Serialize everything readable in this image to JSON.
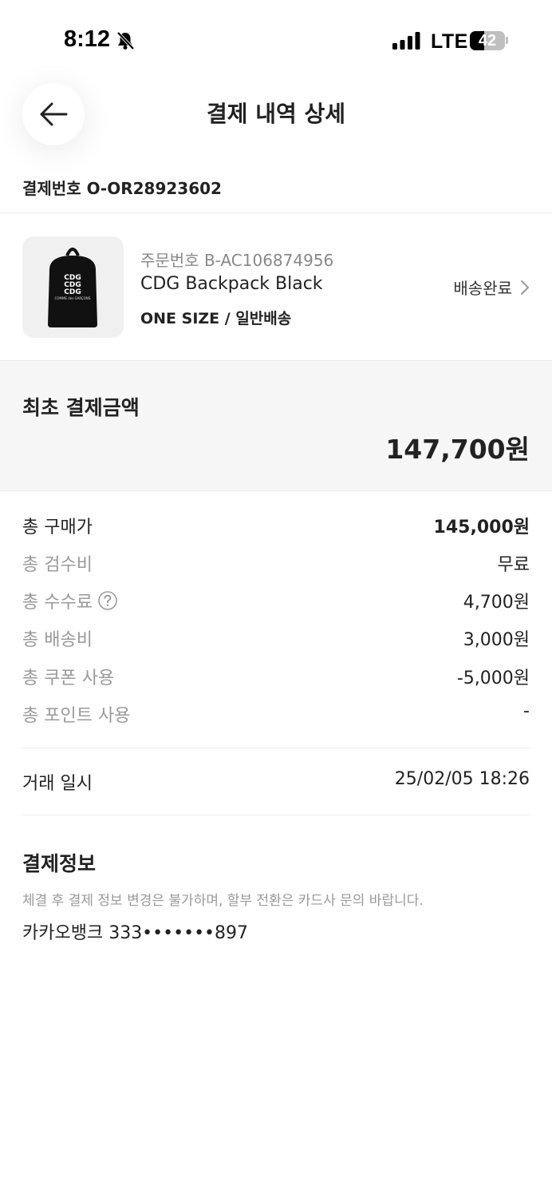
{
  "status_bar": {
    "time": "8:12",
    "network": "LTE",
    "battery": "42",
    "battery_level": 0.42
  },
  "header": {
    "title": "결제 내역 상세",
    "back_icon": "arrow-left-icon"
  },
  "payment_number": "결제번호 O-OR28923602",
  "product": {
    "order_number": "주문번호 B-AC106874956",
    "name": "CDG Backpack Black",
    "option": "ONE SIZE / 일반배송",
    "status": "배송완료",
    "image_text": "CDG",
    "image_small_text": "COMME des GARÇONS"
  },
  "initial_amount": {
    "label": "최초 결제금액",
    "value": "147,700원"
  },
  "fees": [
    {
      "label": "총 구매가",
      "value": "145,000원"
    },
    {
      "label": "총 검수비",
      "value": "무료"
    },
    {
      "label": "총 수수료",
      "value": "4,700원"
    },
    {
      "label": "총 배송비",
      "value": "3,000원"
    },
    {
      "label": "총 쿠폰 사용",
      "value": "-5,000원"
    },
    {
      "label": "총 포인트 사용",
      "value": "-"
    }
  ],
  "transaction": {
    "label": "거래 일시",
    "value": "25/02/05 18:26"
  },
  "payment_info": {
    "title": "결제정보",
    "notice": "체결 후 결제 정보 변경은 불가하며, 할부 전환은 카드사 문의 바랍니다.",
    "account": "카카오뱅크 333•••••••897"
  },
  "colors": {
    "text_primary": "#222222",
    "text_secondary": "#9a9a9a",
    "section_bg": "#f6f6f6",
    "divider": "#ebebeb"
  }
}
